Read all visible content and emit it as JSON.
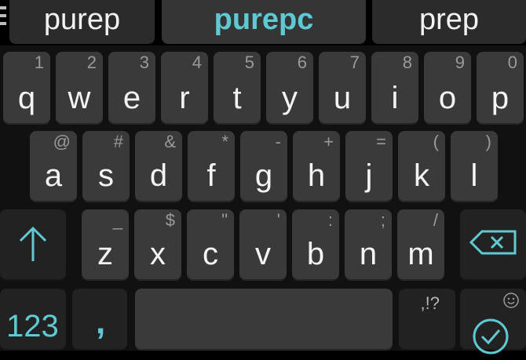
{
  "suggestions": {
    "left": "purep",
    "center": "purepc",
    "right": "prep"
  },
  "row1": [
    {
      "label": "q",
      "secondary": "1"
    },
    {
      "label": "w",
      "secondary": "2"
    },
    {
      "label": "e",
      "secondary": "3"
    },
    {
      "label": "r",
      "secondary": "4"
    },
    {
      "label": "t",
      "secondary": "5"
    },
    {
      "label": "y",
      "secondary": "6"
    },
    {
      "label": "u",
      "secondary": "7"
    },
    {
      "label": "i",
      "secondary": "8"
    },
    {
      "label": "o",
      "secondary": "9"
    },
    {
      "label": "p",
      "secondary": "0"
    }
  ],
  "row2": [
    {
      "label": "a",
      "secondary": "@"
    },
    {
      "label": "s",
      "secondary": "#"
    },
    {
      "label": "d",
      "secondary": "&"
    },
    {
      "label": "f",
      "secondary": "*"
    },
    {
      "label": "g",
      "secondary": "-"
    },
    {
      "label": "h",
      "secondary": "+"
    },
    {
      "label": "j",
      "secondary": "="
    },
    {
      "label": "k",
      "secondary": "("
    },
    {
      "label": "l",
      "secondary": ")"
    }
  ],
  "row3": [
    {
      "label": "z",
      "secondary": "_"
    },
    {
      "label": "x",
      "secondary": "$"
    },
    {
      "label": "c",
      "secondary": "\""
    },
    {
      "label": "v",
      "secondary": "'"
    },
    {
      "label": "b",
      "secondary": ":"
    },
    {
      "label": "n",
      "secondary": ";"
    },
    {
      "label": "m",
      "secondary": "/"
    }
  ],
  "bottom": {
    "numbers_label": "123",
    "comma_label": ",",
    "punct_label": ",!?"
  },
  "colors": {
    "accent": "#5fc9d3",
    "key": "#3a3a3a",
    "background": "#000000"
  },
  "icons": {
    "shift": "shift-arrow-icon",
    "backspace": "backspace-icon",
    "enter": "check-circle-icon",
    "emoji": "smiley-icon",
    "menu": "menu-icon"
  }
}
